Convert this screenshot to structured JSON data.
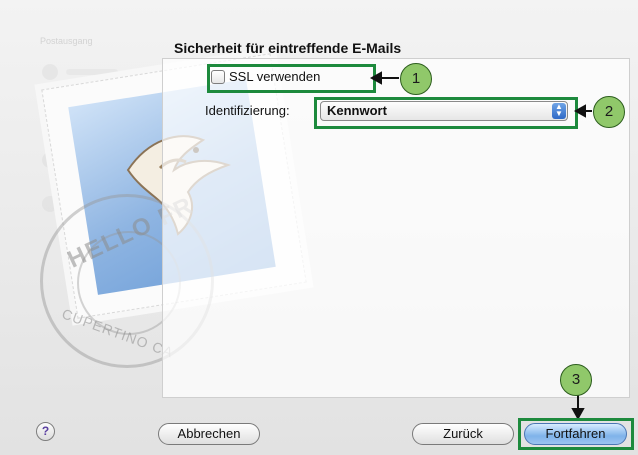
{
  "window": {
    "sidebar_ghost_title": "Postausgang"
  },
  "pane": {
    "title": "Sicherheit für eintreffende E-Mails",
    "ssl_checkbox": {
      "label": "SSL verwenden",
      "checked": false
    },
    "authentication": {
      "label": "Identifizierung:",
      "value": "Kennwort"
    }
  },
  "stamp": {
    "postmark_top": "HELLO FR",
    "postmark_bottom": "CUPERTINO CA"
  },
  "callouts": [
    "1",
    "2",
    "3"
  ],
  "footer": {
    "help": "?",
    "cancel": "Abbrechen",
    "back": "Zurück",
    "continue": "Fortfahren"
  },
  "colors": {
    "callout_border": "#1d8a3d",
    "callout_fill": "#90c86a",
    "default_button": "#7fb3ea"
  }
}
